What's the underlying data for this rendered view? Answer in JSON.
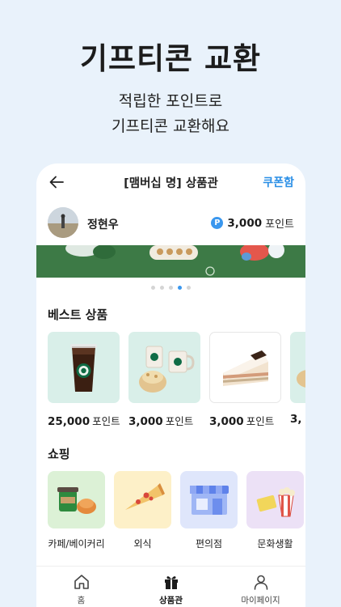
{
  "hero": {
    "title": "기프티콘 교환",
    "subtitle_line1": "적립한 포인트로",
    "subtitle_line2": "기프티콘 교환해요"
  },
  "topbar": {
    "title": "[맴버십 명] 상품관",
    "coupon_label": "쿠폰함",
    "back_icon": "back-arrow-icon"
  },
  "profile": {
    "name": "정현우",
    "points_icon": "P",
    "points_value": "3,000",
    "points_unit": "포인트"
  },
  "banner": {
    "dots_total": 5,
    "active_index": 3
  },
  "best": {
    "title": "베스트 상품",
    "items": [
      {
        "price": "25,000",
        "unit": "포인트",
        "icon": "iced-coffee-icon"
      },
      {
        "price": "3,000",
        "unit": "포인트",
        "icon": "coffee-set-icon"
      },
      {
        "price": "3,000",
        "unit": "포인트",
        "icon": "cake-slice-icon"
      },
      {
        "price": "3,",
        "unit": "",
        "icon": "partial-item-icon"
      }
    ]
  },
  "shopping": {
    "title": "쇼핑",
    "items": [
      {
        "label": "카페/베이커리",
        "icon": "cafe-icon",
        "bg": "#dcf1d6"
      },
      {
        "label": "외식",
        "icon": "pizza-icon",
        "bg": "#fdf0c8"
      },
      {
        "label": "편의점",
        "icon": "store-icon",
        "bg": "#dfe6fb"
      },
      {
        "label": "문화생활",
        "icon": "popcorn-icon",
        "bg": "#ece1f6"
      }
    ]
  },
  "nav": {
    "home": "홈",
    "shop": "상품관",
    "mypage": "마이페이지"
  },
  "colors": {
    "accent": "#2b8fe6",
    "banner": "#3d7a46",
    "page_bg": "#e9f2fb"
  }
}
